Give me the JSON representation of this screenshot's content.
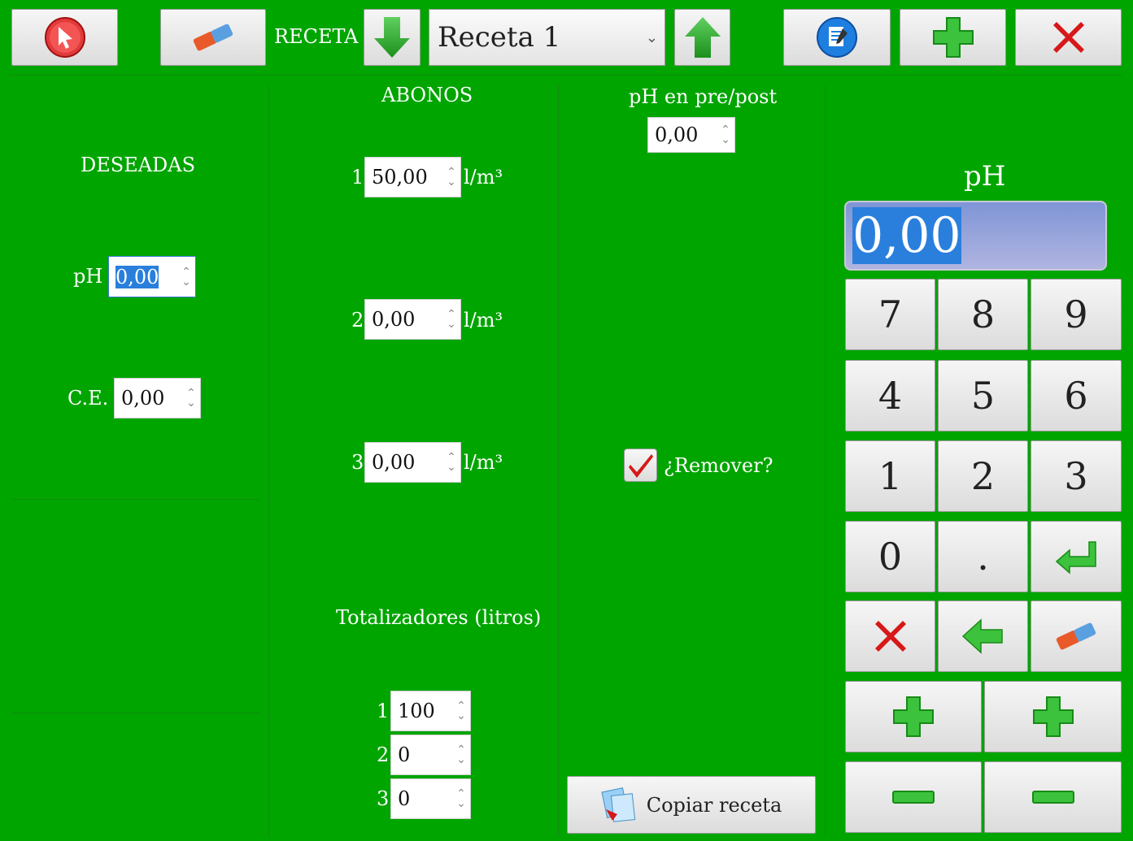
{
  "toolbar": {
    "receta_label": "RECETA",
    "recipe_selected": "Receta 1",
    "icons": [
      "cursor-icon",
      "eraser-icon",
      "arrow-down-icon",
      "arrow-up-icon",
      "edit-icon",
      "plus-icon",
      "close-icon"
    ]
  },
  "deseadas": {
    "title": "DESEADAS",
    "ph_label": "pH",
    "ph_value": "0,00",
    "ce_label": "C.E.",
    "ce_value": "0,00"
  },
  "abonos": {
    "title": "ABONOS",
    "unit": "l/m³",
    "items": [
      {
        "num": "1",
        "value": "50,00"
      },
      {
        "num": "2",
        "value": "0,00"
      },
      {
        "num": "3",
        "value": "0,00"
      }
    ],
    "totalizadores_title": "Totalizadores (litros)",
    "totals": [
      {
        "num": "1",
        "value": "100"
      },
      {
        "num": "2",
        "value": "0"
      },
      {
        "num": "3",
        "value": "0"
      }
    ]
  },
  "prepost": {
    "title": "pH en pre/post",
    "value": "0,00",
    "remover_label": "¿Remover?",
    "remover_checked": true,
    "copy_label": "Copiar receta"
  },
  "keypad": {
    "title": "pH",
    "display": "0,00",
    "keys": [
      "7",
      "8",
      "9",
      "4",
      "5",
      "6",
      "1",
      "2",
      "3",
      "0",
      "."
    ]
  },
  "colors": {
    "background": "#00a500",
    "display_bg": "#8f9ed8",
    "accent_green": "#2fb52f",
    "close_red": "#d71818"
  }
}
